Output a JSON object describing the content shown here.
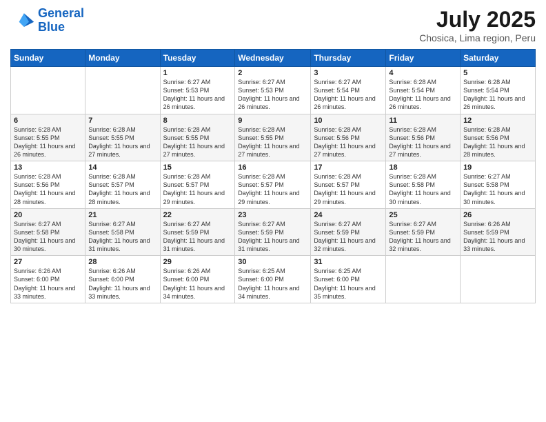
{
  "logo": {
    "line1": "General",
    "line2": "Blue"
  },
  "title": "July 2025",
  "subtitle": "Chosica, Lima region, Peru",
  "days_of_week": [
    "Sunday",
    "Monday",
    "Tuesday",
    "Wednesday",
    "Thursday",
    "Friday",
    "Saturday"
  ],
  "weeks": [
    [
      {
        "day": "",
        "info": ""
      },
      {
        "day": "",
        "info": ""
      },
      {
        "day": "1",
        "info": "Sunrise: 6:27 AM\nSunset: 5:53 PM\nDaylight: 11 hours and 26 minutes."
      },
      {
        "day": "2",
        "info": "Sunrise: 6:27 AM\nSunset: 5:53 PM\nDaylight: 11 hours and 26 minutes."
      },
      {
        "day": "3",
        "info": "Sunrise: 6:27 AM\nSunset: 5:54 PM\nDaylight: 11 hours and 26 minutes."
      },
      {
        "day": "4",
        "info": "Sunrise: 6:28 AM\nSunset: 5:54 PM\nDaylight: 11 hours and 26 minutes."
      },
      {
        "day": "5",
        "info": "Sunrise: 6:28 AM\nSunset: 5:54 PM\nDaylight: 11 hours and 26 minutes."
      }
    ],
    [
      {
        "day": "6",
        "info": "Sunrise: 6:28 AM\nSunset: 5:55 PM\nDaylight: 11 hours and 26 minutes."
      },
      {
        "day": "7",
        "info": "Sunrise: 6:28 AM\nSunset: 5:55 PM\nDaylight: 11 hours and 27 minutes."
      },
      {
        "day": "8",
        "info": "Sunrise: 6:28 AM\nSunset: 5:55 PM\nDaylight: 11 hours and 27 minutes."
      },
      {
        "day": "9",
        "info": "Sunrise: 6:28 AM\nSunset: 5:55 PM\nDaylight: 11 hours and 27 minutes."
      },
      {
        "day": "10",
        "info": "Sunrise: 6:28 AM\nSunset: 5:56 PM\nDaylight: 11 hours and 27 minutes."
      },
      {
        "day": "11",
        "info": "Sunrise: 6:28 AM\nSunset: 5:56 PM\nDaylight: 11 hours and 27 minutes."
      },
      {
        "day": "12",
        "info": "Sunrise: 6:28 AM\nSunset: 5:56 PM\nDaylight: 11 hours and 28 minutes."
      }
    ],
    [
      {
        "day": "13",
        "info": "Sunrise: 6:28 AM\nSunset: 5:56 PM\nDaylight: 11 hours and 28 minutes."
      },
      {
        "day": "14",
        "info": "Sunrise: 6:28 AM\nSunset: 5:57 PM\nDaylight: 11 hours and 28 minutes."
      },
      {
        "day": "15",
        "info": "Sunrise: 6:28 AM\nSunset: 5:57 PM\nDaylight: 11 hours and 29 minutes."
      },
      {
        "day": "16",
        "info": "Sunrise: 6:28 AM\nSunset: 5:57 PM\nDaylight: 11 hours and 29 minutes."
      },
      {
        "day": "17",
        "info": "Sunrise: 6:28 AM\nSunset: 5:57 PM\nDaylight: 11 hours and 29 minutes."
      },
      {
        "day": "18",
        "info": "Sunrise: 6:28 AM\nSunset: 5:58 PM\nDaylight: 11 hours and 30 minutes."
      },
      {
        "day": "19",
        "info": "Sunrise: 6:27 AM\nSunset: 5:58 PM\nDaylight: 11 hours and 30 minutes."
      }
    ],
    [
      {
        "day": "20",
        "info": "Sunrise: 6:27 AM\nSunset: 5:58 PM\nDaylight: 11 hours and 30 minutes."
      },
      {
        "day": "21",
        "info": "Sunrise: 6:27 AM\nSunset: 5:58 PM\nDaylight: 11 hours and 31 minutes."
      },
      {
        "day": "22",
        "info": "Sunrise: 6:27 AM\nSunset: 5:59 PM\nDaylight: 11 hours and 31 minutes."
      },
      {
        "day": "23",
        "info": "Sunrise: 6:27 AM\nSunset: 5:59 PM\nDaylight: 11 hours and 31 minutes."
      },
      {
        "day": "24",
        "info": "Sunrise: 6:27 AM\nSunset: 5:59 PM\nDaylight: 11 hours and 32 minutes."
      },
      {
        "day": "25",
        "info": "Sunrise: 6:27 AM\nSunset: 5:59 PM\nDaylight: 11 hours and 32 minutes."
      },
      {
        "day": "26",
        "info": "Sunrise: 6:26 AM\nSunset: 5:59 PM\nDaylight: 11 hours and 33 minutes."
      }
    ],
    [
      {
        "day": "27",
        "info": "Sunrise: 6:26 AM\nSunset: 6:00 PM\nDaylight: 11 hours and 33 minutes."
      },
      {
        "day": "28",
        "info": "Sunrise: 6:26 AM\nSunset: 6:00 PM\nDaylight: 11 hours and 33 minutes."
      },
      {
        "day": "29",
        "info": "Sunrise: 6:26 AM\nSunset: 6:00 PM\nDaylight: 11 hours and 34 minutes."
      },
      {
        "day": "30",
        "info": "Sunrise: 6:25 AM\nSunset: 6:00 PM\nDaylight: 11 hours and 34 minutes."
      },
      {
        "day": "31",
        "info": "Sunrise: 6:25 AM\nSunset: 6:00 PM\nDaylight: 11 hours and 35 minutes."
      },
      {
        "day": "",
        "info": ""
      },
      {
        "day": "",
        "info": ""
      }
    ]
  ]
}
